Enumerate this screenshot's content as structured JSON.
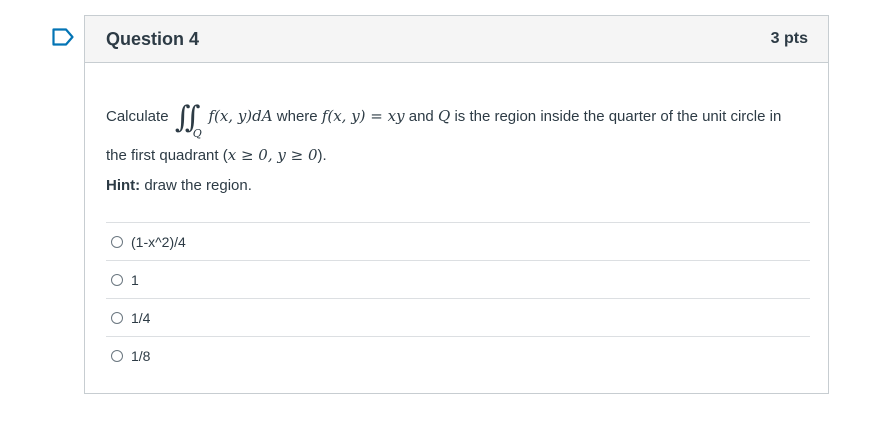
{
  "question": {
    "title": "Question 4",
    "points": "3 pts",
    "prompt": {
      "calculate": "Calculate",
      "integral_symbol": "∬",
      "integral_subscript": "Q",
      "integrand": "f(x, y)dA",
      "where": "where",
      "function_def": "f(x, y) = xy",
      "and": "and",
      "region_letter": "Q",
      "rest": "is the region inside the quarter of the unit circle in the first quadrant (",
      "condition": "x ≥ 0, y ≥ 0",
      "close": ")."
    },
    "hint_label": "Hint:",
    "hint_text": " draw the region."
  },
  "answers": [
    {
      "label": "(1-x^2)/4"
    },
    {
      "label": "1"
    },
    {
      "label": "1/4"
    },
    {
      "label": "1/8"
    }
  ],
  "colors": {
    "accent": "#0374b5",
    "border": "#c7cdd1",
    "header_bg": "#f5f5f5",
    "text": "#2d3b45"
  }
}
